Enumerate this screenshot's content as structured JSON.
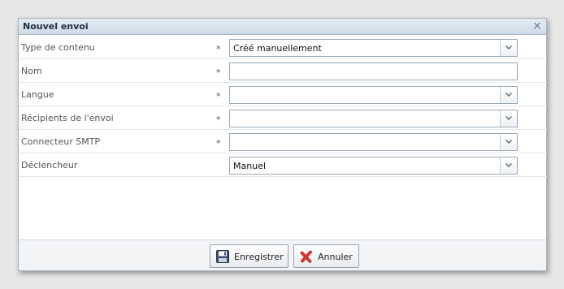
{
  "dialog": {
    "title": "Nouvel envoi",
    "close_glyph": "×"
  },
  "form": {
    "required_marker": "*",
    "rows": [
      {
        "label": "Type de contenu",
        "required": true,
        "kind": "select",
        "value": "Créé manuellement"
      },
      {
        "label": "Nom",
        "required": true,
        "kind": "text",
        "value": ""
      },
      {
        "label": "Langue",
        "required": true,
        "kind": "select",
        "value": ""
      },
      {
        "label": "Récipients de l'envoi",
        "required": true,
        "kind": "select",
        "value": ""
      },
      {
        "label": "Connecteur SMTP",
        "required": true,
        "kind": "select",
        "value": ""
      },
      {
        "label": "Déclencheur",
        "required": false,
        "kind": "select",
        "value": "Manuel"
      }
    ]
  },
  "footer": {
    "save_label": "Enregistrer",
    "cancel_label": "Annuler"
  },
  "icons": {
    "save": "floppy-disk-icon",
    "cancel": "red-x-icon",
    "dropdown": "chevron-down-icon",
    "close": "close-icon"
  }
}
